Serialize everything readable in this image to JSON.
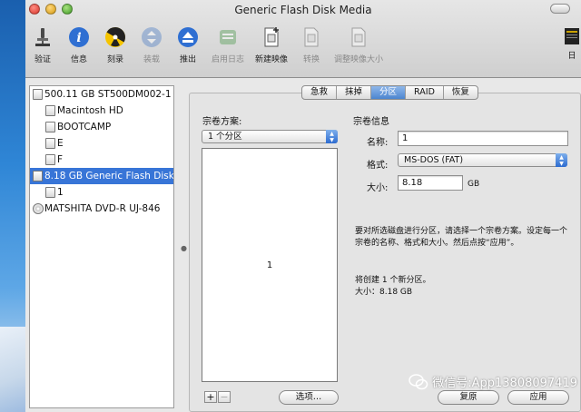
{
  "window": {
    "title": "Generic Flash Disk Media"
  },
  "toolbar": {
    "items": [
      {
        "id": "verify",
        "label": "验证",
        "icon": "microscope-icon",
        "disabled": false
      },
      {
        "id": "info",
        "label": "信息",
        "icon": "info-icon",
        "disabled": false
      },
      {
        "id": "burn",
        "label": "刻录",
        "icon": "burn-icon",
        "disabled": false
      },
      {
        "id": "mount",
        "label": "装载",
        "icon": "mount-icon",
        "disabled": true
      },
      {
        "id": "eject",
        "label": "推出",
        "icon": "eject-icon",
        "disabled": false
      },
      {
        "id": "log",
        "label": "启用日志",
        "icon": "log-icon",
        "disabled": true
      },
      {
        "id": "new-image",
        "label": "新建映像",
        "icon": "new-image-icon",
        "disabled": false
      },
      {
        "id": "convert",
        "label": "转换",
        "icon": "convert-icon",
        "disabled": true
      },
      {
        "id": "resize",
        "label": "调整映像大小",
        "icon": "resize-image-icon",
        "disabled": true
      }
    ],
    "right_label": "日"
  },
  "sidebar": {
    "items": [
      {
        "label": "500.11 GB ST500DM002-1",
        "level": "top"
      },
      {
        "label": "Macintosh HD",
        "level": "child"
      },
      {
        "label": "BOOTCAMP",
        "level": "child"
      },
      {
        "label": "E",
        "level": "child"
      },
      {
        "label": "F",
        "level": "child"
      },
      {
        "label": "8.18 GB Generic Flash Disk",
        "level": "top",
        "selected": true
      },
      {
        "label": "1",
        "level": "child"
      },
      {
        "label": "MATSHITA DVD-R UJ-846",
        "level": "disc"
      }
    ]
  },
  "tabs": [
    {
      "label": "急救",
      "active": false
    },
    {
      "label": "抹掉",
      "active": false
    },
    {
      "label": "分区",
      "active": true
    },
    {
      "label": "RAID",
      "active": false
    },
    {
      "label": "恢复",
      "active": false
    }
  ],
  "partition": {
    "scheme_label": "宗卷方案:",
    "scheme_value": "1 个分区",
    "layout_partition_label": "1",
    "add_label": "+",
    "remove_label": "−",
    "options_label": "选项…"
  },
  "volume": {
    "section_label": "宗卷信息",
    "name_label": "名称:",
    "name_value": "1",
    "format_label": "格式:",
    "format_value": "MS-DOS (FAT)",
    "size_label": "大小:",
    "size_value": "8.18",
    "size_unit": "GB",
    "instruction": "要对所选磁盘进行分区，请选择一个宗卷方案。设定每一个宗卷的名称、格式和大小。然后点按“应用”。",
    "summary_line1": "将创建 1 个新分区。",
    "summary_line2": "大小：8.18 GB"
  },
  "buttons": {
    "revert": "复原",
    "apply": "应用"
  },
  "watermark": {
    "text": "微信号:App13808097419"
  },
  "colors": {
    "selection": "#3875d7",
    "accent": "#4c85cf"
  }
}
